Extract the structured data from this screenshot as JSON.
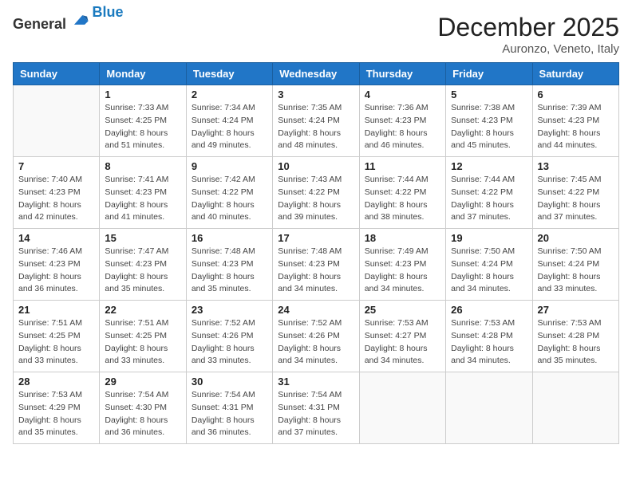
{
  "logo": {
    "general": "General",
    "blue": "Blue"
  },
  "title": {
    "month": "December 2025",
    "location": "Auronzo, Veneto, Italy"
  },
  "headers": [
    "Sunday",
    "Monday",
    "Tuesday",
    "Wednesday",
    "Thursday",
    "Friday",
    "Saturday"
  ],
  "weeks": [
    [
      {
        "day": "",
        "sunrise": "",
        "sunset": "",
        "daylight": ""
      },
      {
        "day": "1",
        "sunrise": "Sunrise: 7:33 AM",
        "sunset": "Sunset: 4:25 PM",
        "daylight": "Daylight: 8 hours and 51 minutes."
      },
      {
        "day": "2",
        "sunrise": "Sunrise: 7:34 AM",
        "sunset": "Sunset: 4:24 PM",
        "daylight": "Daylight: 8 hours and 49 minutes."
      },
      {
        "day": "3",
        "sunrise": "Sunrise: 7:35 AM",
        "sunset": "Sunset: 4:24 PM",
        "daylight": "Daylight: 8 hours and 48 minutes."
      },
      {
        "day": "4",
        "sunrise": "Sunrise: 7:36 AM",
        "sunset": "Sunset: 4:23 PM",
        "daylight": "Daylight: 8 hours and 46 minutes."
      },
      {
        "day": "5",
        "sunrise": "Sunrise: 7:38 AM",
        "sunset": "Sunset: 4:23 PM",
        "daylight": "Daylight: 8 hours and 45 minutes."
      },
      {
        "day": "6",
        "sunrise": "Sunrise: 7:39 AM",
        "sunset": "Sunset: 4:23 PM",
        "daylight": "Daylight: 8 hours and 44 minutes."
      }
    ],
    [
      {
        "day": "7",
        "sunrise": "Sunrise: 7:40 AM",
        "sunset": "Sunset: 4:23 PM",
        "daylight": "Daylight: 8 hours and 42 minutes."
      },
      {
        "day": "8",
        "sunrise": "Sunrise: 7:41 AM",
        "sunset": "Sunset: 4:23 PM",
        "daylight": "Daylight: 8 hours and 41 minutes."
      },
      {
        "day": "9",
        "sunrise": "Sunrise: 7:42 AM",
        "sunset": "Sunset: 4:22 PM",
        "daylight": "Daylight: 8 hours and 40 minutes."
      },
      {
        "day": "10",
        "sunrise": "Sunrise: 7:43 AM",
        "sunset": "Sunset: 4:22 PM",
        "daylight": "Daylight: 8 hours and 39 minutes."
      },
      {
        "day": "11",
        "sunrise": "Sunrise: 7:44 AM",
        "sunset": "Sunset: 4:22 PM",
        "daylight": "Daylight: 8 hours and 38 minutes."
      },
      {
        "day": "12",
        "sunrise": "Sunrise: 7:44 AM",
        "sunset": "Sunset: 4:22 PM",
        "daylight": "Daylight: 8 hours and 37 minutes."
      },
      {
        "day": "13",
        "sunrise": "Sunrise: 7:45 AM",
        "sunset": "Sunset: 4:22 PM",
        "daylight": "Daylight: 8 hours and 37 minutes."
      }
    ],
    [
      {
        "day": "14",
        "sunrise": "Sunrise: 7:46 AM",
        "sunset": "Sunset: 4:23 PM",
        "daylight": "Daylight: 8 hours and 36 minutes."
      },
      {
        "day": "15",
        "sunrise": "Sunrise: 7:47 AM",
        "sunset": "Sunset: 4:23 PM",
        "daylight": "Daylight: 8 hours and 35 minutes."
      },
      {
        "day": "16",
        "sunrise": "Sunrise: 7:48 AM",
        "sunset": "Sunset: 4:23 PM",
        "daylight": "Daylight: 8 hours and 35 minutes."
      },
      {
        "day": "17",
        "sunrise": "Sunrise: 7:48 AM",
        "sunset": "Sunset: 4:23 PM",
        "daylight": "Daylight: 8 hours and 34 minutes."
      },
      {
        "day": "18",
        "sunrise": "Sunrise: 7:49 AM",
        "sunset": "Sunset: 4:23 PM",
        "daylight": "Daylight: 8 hours and 34 minutes."
      },
      {
        "day": "19",
        "sunrise": "Sunrise: 7:50 AM",
        "sunset": "Sunset: 4:24 PM",
        "daylight": "Daylight: 8 hours and 34 minutes."
      },
      {
        "day": "20",
        "sunrise": "Sunrise: 7:50 AM",
        "sunset": "Sunset: 4:24 PM",
        "daylight": "Daylight: 8 hours and 33 minutes."
      }
    ],
    [
      {
        "day": "21",
        "sunrise": "Sunrise: 7:51 AM",
        "sunset": "Sunset: 4:25 PM",
        "daylight": "Daylight: 8 hours and 33 minutes."
      },
      {
        "day": "22",
        "sunrise": "Sunrise: 7:51 AM",
        "sunset": "Sunset: 4:25 PM",
        "daylight": "Daylight: 8 hours and 33 minutes."
      },
      {
        "day": "23",
        "sunrise": "Sunrise: 7:52 AM",
        "sunset": "Sunset: 4:26 PM",
        "daylight": "Daylight: 8 hours and 33 minutes."
      },
      {
        "day": "24",
        "sunrise": "Sunrise: 7:52 AM",
        "sunset": "Sunset: 4:26 PM",
        "daylight": "Daylight: 8 hours and 34 minutes."
      },
      {
        "day": "25",
        "sunrise": "Sunrise: 7:53 AM",
        "sunset": "Sunset: 4:27 PM",
        "daylight": "Daylight: 8 hours and 34 minutes."
      },
      {
        "day": "26",
        "sunrise": "Sunrise: 7:53 AM",
        "sunset": "Sunset: 4:28 PM",
        "daylight": "Daylight: 8 hours and 34 minutes."
      },
      {
        "day": "27",
        "sunrise": "Sunrise: 7:53 AM",
        "sunset": "Sunset: 4:28 PM",
        "daylight": "Daylight: 8 hours and 35 minutes."
      }
    ],
    [
      {
        "day": "28",
        "sunrise": "Sunrise: 7:53 AM",
        "sunset": "Sunset: 4:29 PM",
        "daylight": "Daylight: 8 hours and 35 minutes."
      },
      {
        "day": "29",
        "sunrise": "Sunrise: 7:54 AM",
        "sunset": "Sunset: 4:30 PM",
        "daylight": "Daylight: 8 hours and 36 minutes."
      },
      {
        "day": "30",
        "sunrise": "Sunrise: 7:54 AM",
        "sunset": "Sunset: 4:31 PM",
        "daylight": "Daylight: 8 hours and 36 minutes."
      },
      {
        "day": "31",
        "sunrise": "Sunrise: 7:54 AM",
        "sunset": "Sunset: 4:31 PM",
        "daylight": "Daylight: 8 hours and 37 minutes."
      },
      {
        "day": "",
        "sunrise": "",
        "sunset": "",
        "daylight": ""
      },
      {
        "day": "",
        "sunrise": "",
        "sunset": "",
        "daylight": ""
      },
      {
        "day": "",
        "sunrise": "",
        "sunset": "",
        "daylight": ""
      }
    ]
  ]
}
